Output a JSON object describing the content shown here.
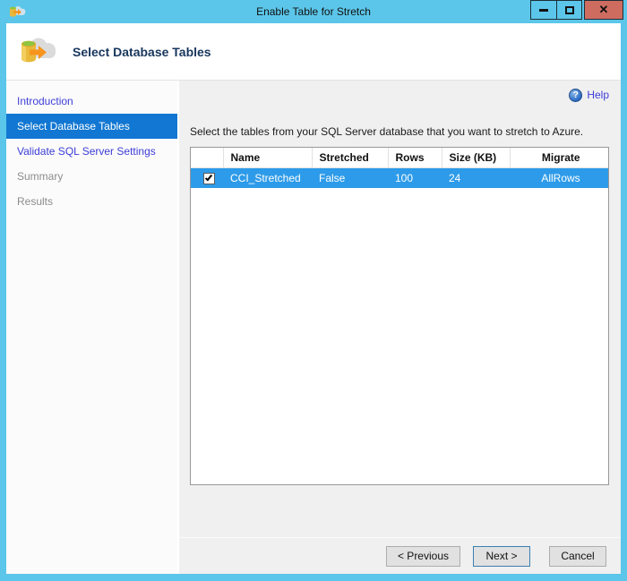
{
  "window": {
    "title": "Enable Table for Stretch",
    "close_glyph": "✕"
  },
  "header": {
    "title": "Select Database Tables"
  },
  "sidebar": {
    "items": [
      {
        "label": "Introduction",
        "state": "link"
      },
      {
        "label": "Select Database Tables",
        "state": "selected"
      },
      {
        "label": "Validate SQL Server Settings",
        "state": "link"
      },
      {
        "label": "Summary",
        "state": "disabled"
      },
      {
        "label": "Results",
        "state": "disabled"
      }
    ]
  },
  "main": {
    "help_label": "Help",
    "help_icon_glyph": "?",
    "instruction": "Select the tables from your SQL Server database that you want to stretch to Azure.",
    "table": {
      "columns": [
        "",
        "Name",
        "Stretched",
        "Rows",
        "Size (KB)",
        "Migrate"
      ],
      "rows": [
        {
          "checked": true,
          "selected": true,
          "name": "CCI_Stretched",
          "stretched": "False",
          "rows": "100",
          "size_kb": "24",
          "migrate": "AllRows"
        }
      ]
    }
  },
  "footer": {
    "previous_label": "< Previous",
    "next_label": "Next >",
    "cancel_label": "Cancel"
  },
  "colors": {
    "titlebar": "#5BC6E9",
    "close_button": "#CE6C60",
    "sidebar_selected": "#1177D2",
    "row_selected": "#2D9BE9",
    "link": "#3D3DD8",
    "disabled_text": "#8C8C8C"
  }
}
